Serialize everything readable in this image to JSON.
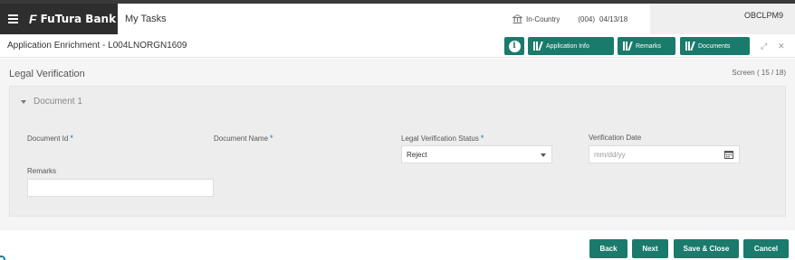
{
  "header": {
    "brand": "FuTura Bank",
    "my_tasks": "My Tasks",
    "location": "In-Country",
    "branch": "(004)",
    "date": "04/13/18",
    "user": "OBCLPM9"
  },
  "titlebar": {
    "title": "Application Enrichment - L004LNORGN1609",
    "info_label": "i",
    "application_info": "Application Info",
    "remarks": "Remarks",
    "documents": "Documents"
  },
  "page": {
    "section_title": "Legal Verification",
    "screen_count": "Screen ( 15 / 18)"
  },
  "document": {
    "heading": "Document 1",
    "document_id_label": "Document Id",
    "document_name_label": "Document Name",
    "status_label": "Legal Verification Status",
    "status_value": "Reject",
    "verification_date_label": "Verification Date",
    "verification_date_placeholder": "mm/dd/yy",
    "remarks_label": "Remarks",
    "required_marker": "*"
  },
  "footer": {
    "back": "Back",
    "next": "Next",
    "save_close": "Save & Close",
    "cancel": "Cancel"
  },
  "colors": {
    "accent": "#1a7a6b",
    "brand_bg": "#2e2e2e"
  }
}
